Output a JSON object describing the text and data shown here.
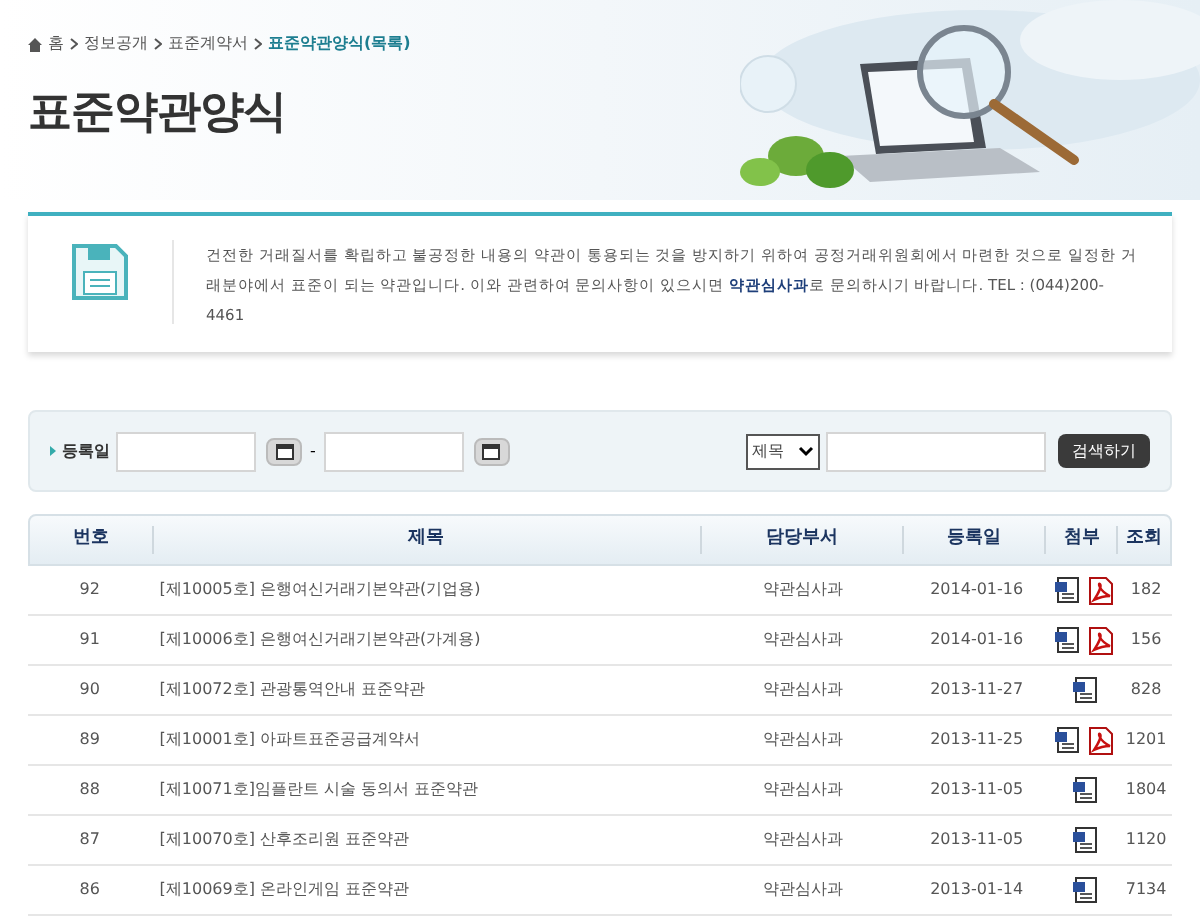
{
  "breadcrumb": {
    "items": [
      "홈",
      "정보공개",
      "표준계약서"
    ],
    "current": "표준약관양식(목록)"
  },
  "page_title": "표준약관양식",
  "info": {
    "text_before": "건전한 거래질서를 확립하고 불공정한 내용의 약관이 통용되는 것을 방지하기 위하여 공정거래위원회에서 마련한 것으로 일정한 거래분야에서 표준이 되는 약관입니다. 이와 관련하여 문의사항이 있으시면 ",
    "link": "약관심사과",
    "text_after": "로 문의하시기 바랍니다. TEL : (044)200-4461"
  },
  "search": {
    "date_label": "등록일",
    "separator": "-",
    "select_value": "제목",
    "button": "검색하기"
  },
  "table": {
    "columns": [
      "번호",
      "제목",
      "담당부서",
      "등록일",
      "첨부",
      "조회"
    ],
    "rows": [
      {
        "no": "92",
        "title": "[제10005호] 은행여신거래기본약관(기업용)",
        "dept": "약관심사과",
        "date": "2014-01-16",
        "attachments": [
          {
            "kind": "document"
          },
          {
            "kind": "pdf"
          }
        ],
        "views": "182"
      },
      {
        "no": "91",
        "title": "[제10006호] 은행여신거래기본약관(가계용)",
        "dept": "약관심사과",
        "date": "2014-01-16",
        "attachments": [
          {
            "kind": "document"
          },
          {
            "kind": "pdf"
          }
        ],
        "views": "156"
      },
      {
        "no": "90",
        "title": "[제10072호] 관광통역안내 표준약관",
        "dept": "약관심사과",
        "date": "2013-11-27",
        "attachments": [
          {
            "kind": "document"
          }
        ],
        "views": "828"
      },
      {
        "no": "89",
        "title": "[제10001호] 아파트표준공급계약서",
        "dept": "약관심사과",
        "date": "2013-11-25",
        "attachments": [
          {
            "kind": "document"
          },
          {
            "kind": "pdf"
          }
        ],
        "views": "1201"
      },
      {
        "no": "88",
        "title": "[제10071호]임플란트 시술 동의서 표준약관",
        "dept": "약관심사과",
        "date": "2013-11-05",
        "attachments": [
          {
            "kind": "document"
          }
        ],
        "views": "1804"
      },
      {
        "no": "87",
        "title": "[제10070호] 산후조리원 표준약관",
        "dept": "약관심사과",
        "date": "2013-11-05",
        "attachments": [
          {
            "kind": "document"
          }
        ],
        "views": "1120"
      },
      {
        "no": "86",
        "title": "[제10069호] 온라인게임 표준약관",
        "dept": "약관심사과",
        "date": "2013-01-14",
        "attachments": [
          {
            "kind": "document"
          }
        ],
        "views": "7134"
      }
    ]
  }
}
